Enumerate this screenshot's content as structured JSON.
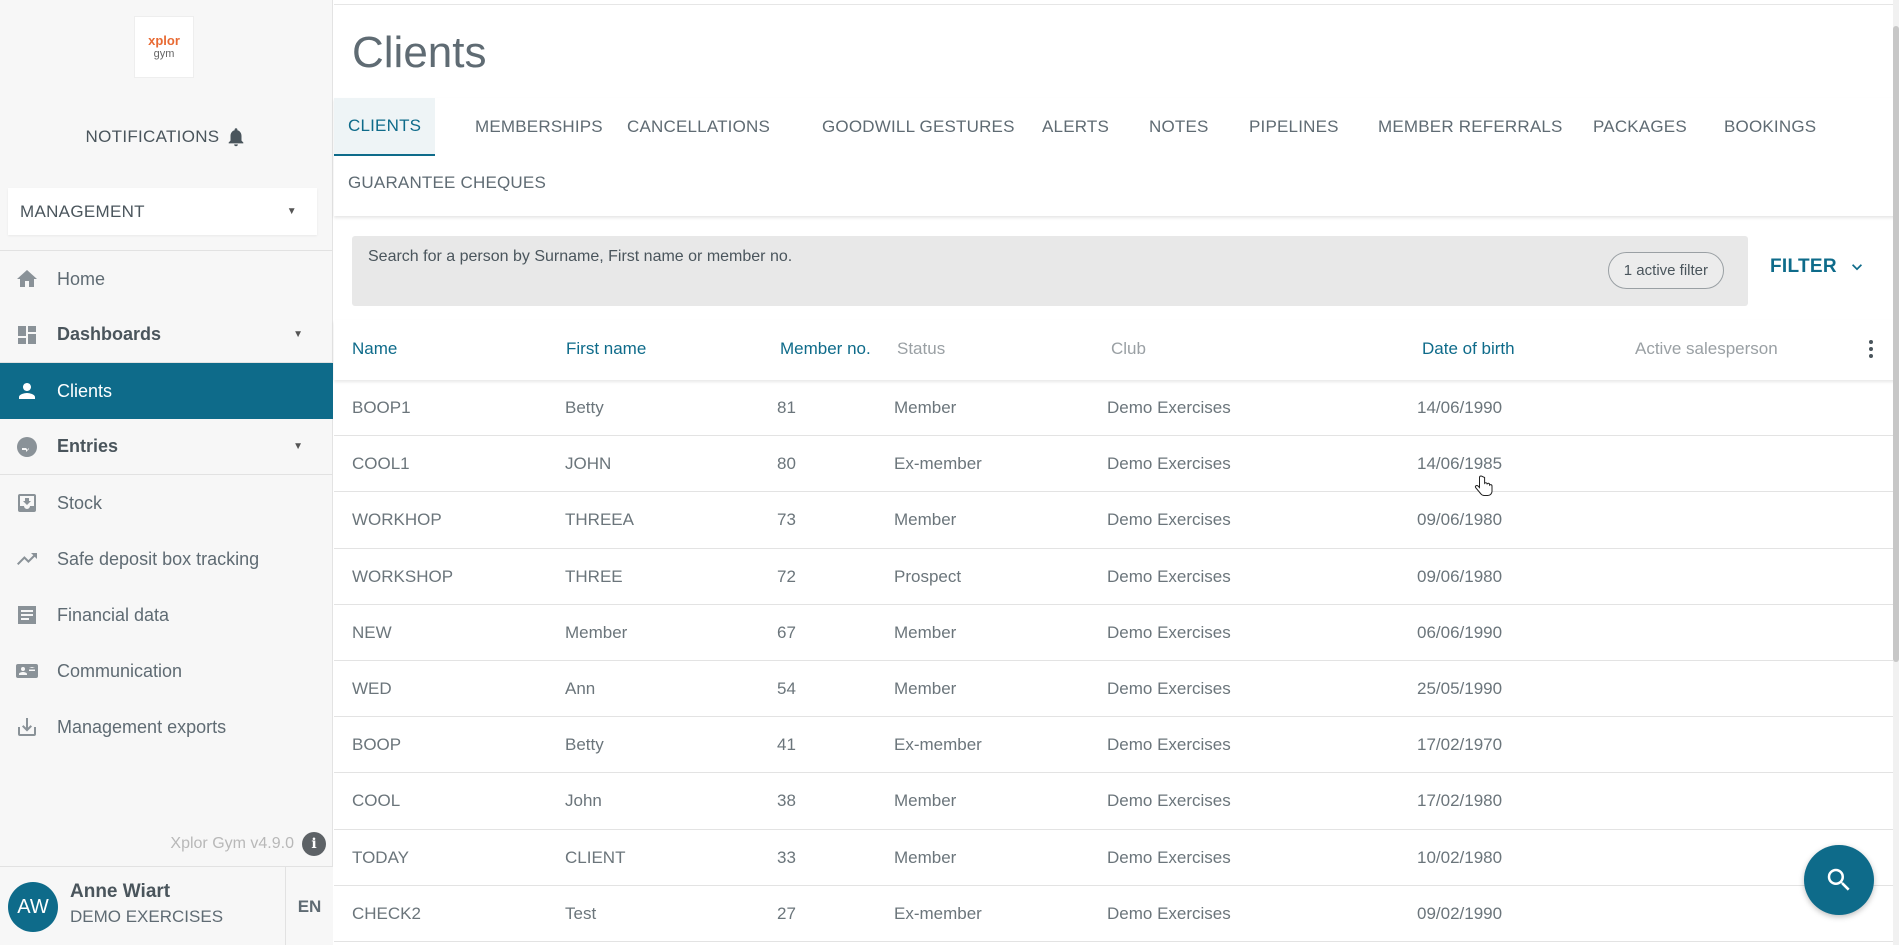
{
  "sidebar": {
    "logo": {
      "line1": "xplor",
      "line2": "gym"
    },
    "notifications_label": "NOTIFICATIONS",
    "context_select": "MANAGEMENT",
    "items": [
      {
        "label": "Home",
        "icon": "home-icon"
      },
      {
        "label": "Dashboards",
        "icon": "dashboard-icon",
        "expandable": true
      },
      {
        "label": "Clients",
        "icon": "person-icon",
        "active": true
      },
      {
        "label": "Entries",
        "icon": "entries-icon",
        "expandable": true
      },
      {
        "label": "Stock",
        "icon": "inbox-download-icon"
      },
      {
        "label": "Safe deposit box tracking",
        "icon": "trending-up-icon"
      },
      {
        "label": "Financial data",
        "icon": "receipt-icon"
      },
      {
        "label": "Communication",
        "icon": "contact-mail-icon"
      },
      {
        "label": "Management exports",
        "icon": "download-icon"
      }
    ],
    "version": "Xplor Gym v4.9.0",
    "user": {
      "initials": "AW",
      "name": "Anne Wiart",
      "club": "DEMO EXERCISES"
    },
    "language": "EN"
  },
  "main": {
    "title": "Clients",
    "tabs": [
      "CLIENTS",
      "MEMBERSHIPS",
      "CANCELLATIONS",
      "GOODWILL GESTURES",
      "ALERTS",
      "NOTES",
      "PIPELINES",
      "MEMBER REFERRALS",
      "PACKAGES",
      "BOOKINGS",
      "GUARANTEE CHEQUES"
    ],
    "search_placeholder": "Search for a person by Surname, First name or member no.",
    "active_filter_label": "1 active filter",
    "filter_button": "FILTER",
    "columns": [
      "Name",
      "First name",
      "Member no.",
      "Status",
      "Club",
      "Date of birth",
      "Active salesperson"
    ],
    "rows": [
      [
        "BOOP1",
        "Betty",
        "81",
        "Member",
        "Demo Exercises",
        "14/06/1990",
        ""
      ],
      [
        "COOL1",
        "JOHN",
        "80",
        "Ex-member",
        "Demo Exercises",
        "14/06/1985",
        ""
      ],
      [
        "WORKHOP",
        "THREEA",
        "73",
        "Member",
        "Demo Exercises",
        "09/06/1980",
        ""
      ],
      [
        "WORKSHOP",
        "THREE",
        "72",
        "Prospect",
        "Demo Exercises",
        "09/06/1980",
        ""
      ],
      [
        "NEW",
        "Member",
        "67",
        "Member",
        "Demo Exercises",
        "06/06/1990",
        ""
      ],
      [
        "WED",
        "Ann",
        "54",
        "Member",
        "Demo Exercises",
        "25/05/1990",
        ""
      ],
      [
        "BOOP",
        "Betty",
        "41",
        "Ex-member",
        "Demo Exercises",
        "17/02/1970",
        ""
      ],
      [
        "COOL",
        "John",
        "38",
        "Member",
        "Demo Exercises",
        "17/02/1980",
        ""
      ],
      [
        "TODAY",
        "CLIENT",
        "33",
        "Member",
        "Demo Exercises",
        "10/02/1980",
        ""
      ],
      [
        "CHECK2",
        "Test",
        "27",
        "Ex-member",
        "Demo Exercises",
        "09/02/1990",
        ""
      ]
    ]
  }
}
